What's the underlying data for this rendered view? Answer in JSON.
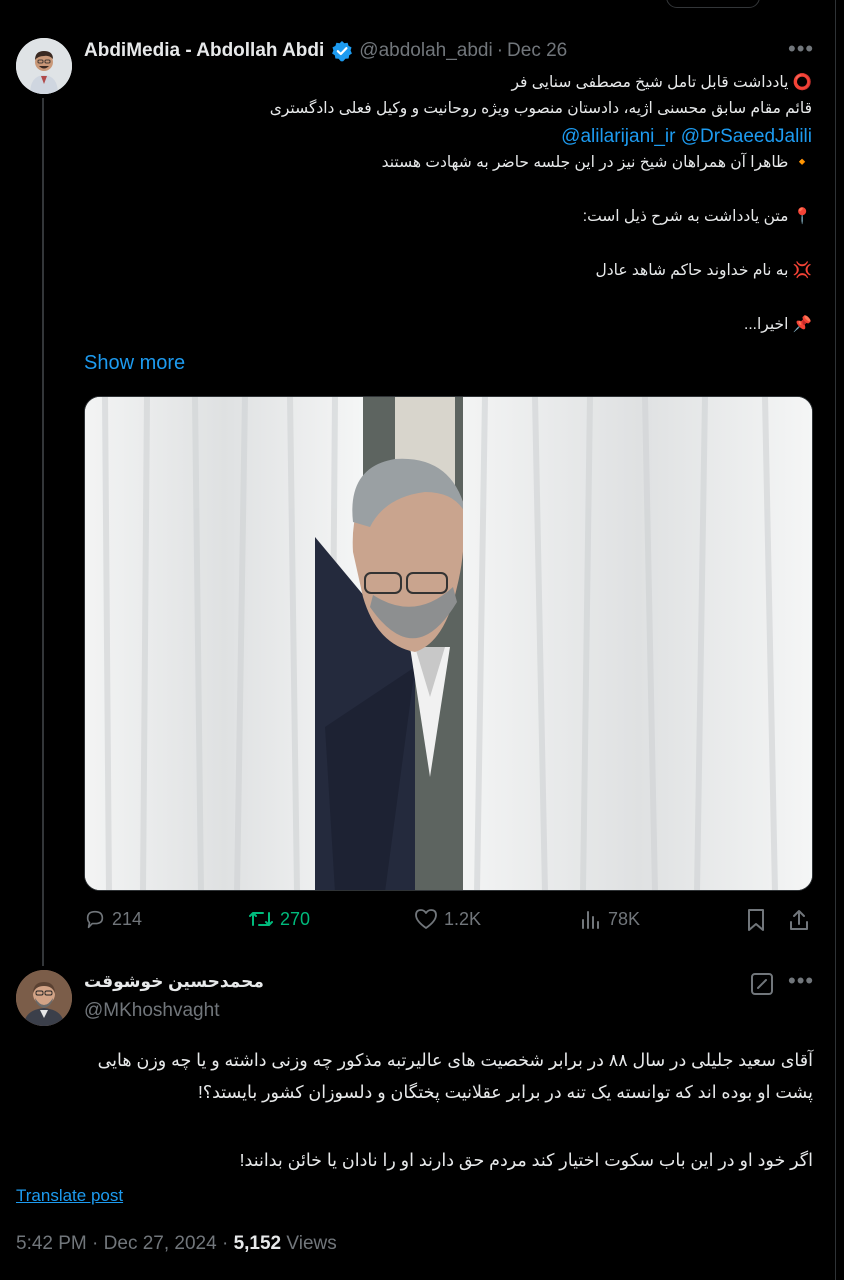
{
  "tweet": {
    "display_name": "AbdiMedia - Abdollah Abdi",
    "handle": "@abdolah_abdi",
    "separator": "·",
    "date": "Dec 26",
    "lines": [
      "⭕ یادداشت قابل تامل شیخ مصطفی سنایی فر",
      "قائم مقام سابق محسنی اژیه، دادستان منصوب ویژه روحانیت و وکیل فعلی دادگستری",
      "🔸 ظاهرا آن همراهان شیخ نیز در این جلسه حاضر به شهادت هستند",
      "📍 متن یادداشت به شرح ذیل است:",
      "💢 به نام خداوند حاکم شاهد عادل",
      "📌 اخیرا..."
    ],
    "mentions": [
      "@alilarijani_ir",
      "@DrSaeedJalili"
    ],
    "show_more": "Show more",
    "stats": {
      "replies": "214",
      "retweets": "270",
      "likes": "1.2K",
      "views": "78K"
    }
  },
  "reply": {
    "display_name": "محمدحسین خوشوقت",
    "handle": "@MKhoshvaght",
    "lines": [
      "آقای سعید جلیلی در سال ۸۸ در برابر شخصیت های عالیرتبه مذکور چه وزنی داشته و یا چه وزن هایی",
      "پشت او بوده اند که توانسته یک تنه در برابر عقلانیت پختگان و دلسوزان کشور بایستد؟!",
      "اگر خود او در این باب سکوت اختیار کند مردم حق دارند او را نادان یا خائن بدانند!"
    ],
    "translate_label": "Translate post",
    "time": "5:42 PM",
    "separator": "·",
    "date": "Dec 27, 2024",
    "views_count": "5,152",
    "views_label": "Views"
  },
  "colors": {
    "background": "#000000",
    "text": "#e7e9ea",
    "muted": "#71767b",
    "accent": "#1d9bf0",
    "retweet": "#00ba7c"
  },
  "icons": [
    "verified-badge-icon",
    "more-icon",
    "reply-icon",
    "retweet-icon",
    "like-icon",
    "views-icon",
    "bookmark-icon",
    "share-icon",
    "grok-icon"
  ]
}
